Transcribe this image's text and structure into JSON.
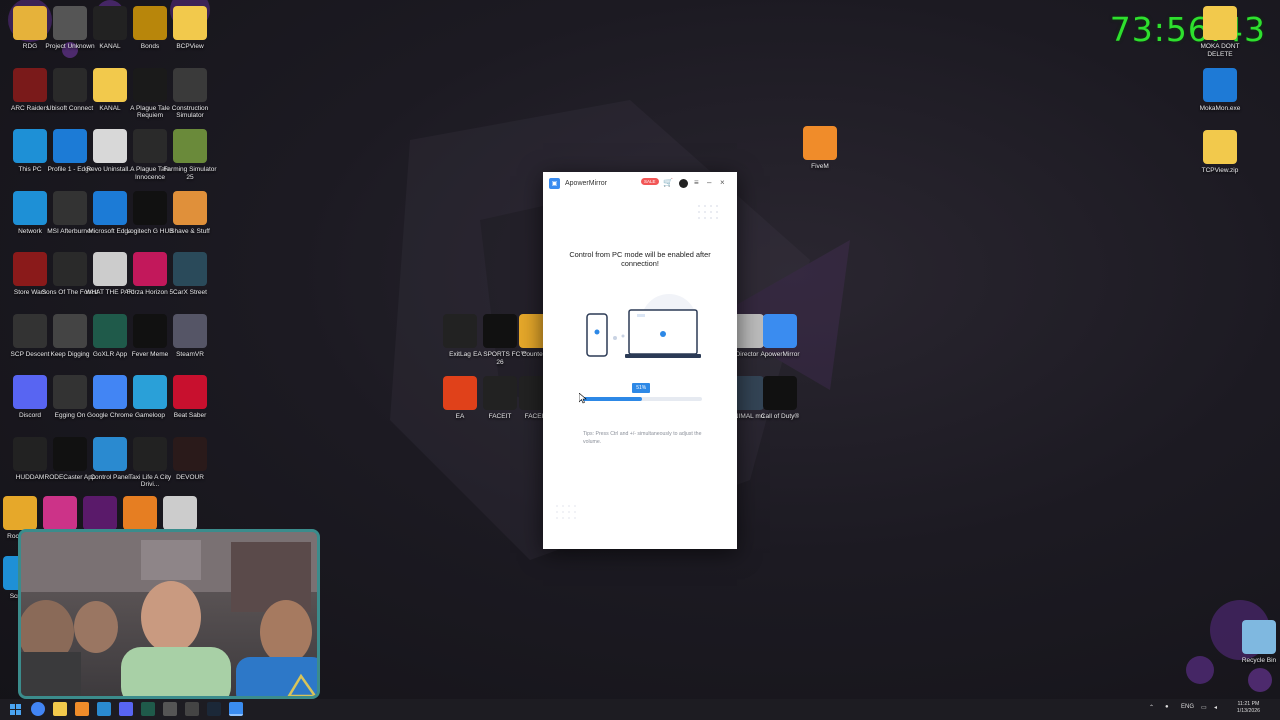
{
  "stream": {
    "timer": "73:56:43"
  },
  "desktop": {
    "left_icons": [
      {
        "label": "RDG",
        "icon": "folder-person-icon",
        "color": "#e6b23a"
      },
      {
        "label": "Project Unknown",
        "icon": "app-icon",
        "color": "#555555"
      },
      {
        "label": "KANAL",
        "icon": "network-graph-icon",
        "color": "#222222"
      },
      {
        "label": "Bonds",
        "icon": "bn-logo-icon",
        "color": "#b8860b"
      },
      {
        "label": "BCPView",
        "icon": "folder-icon",
        "color": "#f2c94c"
      },
      {
        "label": "ARC Raiders",
        "icon": "arc-raiders-icon",
        "color": "#7a1a1a"
      },
      {
        "label": "Ubisoft Connect",
        "icon": "ubisoft-icon",
        "color": "#2a2a2a"
      },
      {
        "label": "KANAL",
        "icon": "folder-icon",
        "color": "#f2c94c"
      },
      {
        "label": "A Plague Tale Requiem",
        "icon": "plague-tale-icon",
        "color": "#1a1a1a"
      },
      {
        "label": "Construction Simulator",
        "icon": "construction-sim-icon",
        "color": "#3a3a3a"
      },
      {
        "label": "This PC",
        "icon": "monitor-icon",
        "color": "#1e90d6"
      },
      {
        "label": "Profile 1 - Edge",
        "icon": "edge-icon",
        "color": "#1c7bd6"
      },
      {
        "label": "Revo Uninstall...",
        "icon": "recycle-icon",
        "color": "#d8d8d8"
      },
      {
        "label": "A Plague Tale Innocence",
        "icon": "plague-tale-icon",
        "color": "#2a2a2a"
      },
      {
        "label": "Farming Simulator 25",
        "icon": "farming-sim-icon",
        "color": "#6a8a3a"
      },
      {
        "label": "Network",
        "icon": "network-icon",
        "color": "#1e90d6"
      },
      {
        "label": "MSI Afterburner",
        "icon": "afterburner-icon",
        "color": "#333333"
      },
      {
        "label": "Microsoft Edge",
        "icon": "edge-icon",
        "color": "#1c7bd6"
      },
      {
        "label": "Logitech G HUB",
        "icon": "logitech-icon",
        "color": "#111111"
      },
      {
        "label": "Shave & Stuff",
        "icon": "shave-icon",
        "color": "#e0903a"
      },
      {
        "label": "Store Wars",
        "icon": "store-wars-icon",
        "color": "#8a1a1a"
      },
      {
        "label": "Sons Of The Forest",
        "icon": "sons-forest-icon",
        "color": "#2a2a2a"
      },
      {
        "label": "WHAT THE PAK!",
        "icon": "pak-icon",
        "color": "#cccccc"
      },
      {
        "label": "Forza Horizon 5",
        "icon": "forza-icon",
        "color": "#c2185b"
      },
      {
        "label": "CarX Street",
        "icon": "carx-icon",
        "color": "#2a4a5a"
      },
      {
        "label": "SCP Descent",
        "icon": "scp-icon",
        "color": "#333333"
      },
      {
        "label": "Keep Digging",
        "icon": "pickaxe-icon",
        "color": "#444444"
      },
      {
        "label": "GoXLR App",
        "icon": "goxlr-icon",
        "color": "#1f5a4a"
      },
      {
        "label": "Fever Meme",
        "icon": "fm-icon",
        "color": "#111111"
      },
      {
        "label": "SteamVR",
        "icon": "vr-icon",
        "color": "#555566"
      },
      {
        "label": "Discord",
        "icon": "discord-icon",
        "color": "#5865f2"
      },
      {
        "label": "Egging On",
        "icon": "egg-icon",
        "color": "#333333"
      },
      {
        "label": "Google Chrome",
        "icon": "chrome-icon",
        "color": "#4285f4"
      },
      {
        "label": "Gameloop",
        "icon": "gameloop-icon",
        "color": "#2aa0d8"
      },
      {
        "label": "Beat Saber",
        "icon": "beat-saber-icon",
        "color": "#c8102e"
      },
      {
        "label": "HUDDAM",
        "icon": "huddam-icon",
        "color": "#222222"
      },
      {
        "label": "RODECaster App",
        "icon": "rodecaster-icon",
        "color": "#111111"
      },
      {
        "label": "Control Panel",
        "icon": "control-panel-icon",
        "color": "#2a8ad0"
      },
      {
        "label": "Taxi Life A City Drivi...",
        "icon": "taxi-icon",
        "color": "#222222"
      },
      {
        "label": "DEVOUR",
        "icon": "devour-icon",
        "color": "#2a1a1a"
      }
    ],
    "extra_left_icons": [
      {
        "label": "Rocl Gar",
        "icon": "rocket-league-icon",
        "color": "#e6a82a"
      },
      {
        "label": "",
        "icon": "game-icon",
        "color": "#cc3388"
      },
      {
        "label": "",
        "icon": "game-icon",
        "color": "#5a1a6a"
      },
      {
        "label": "",
        "icon": "game-icon",
        "color": "#e67e22"
      },
      {
        "label": "",
        "icon": "r-logo-icon",
        "color": "#cccccc"
      },
      {
        "label": "Screen",
        "icon": "screen-icon",
        "color": "#1e90d6"
      }
    ],
    "middle_icons": [
      {
        "label": "ExitLag",
        "icon": "exitlag-icon",
        "color": "#222222"
      },
      {
        "label": "EA SPORTS FC™ 26",
        "icon": "ea-fc-icon",
        "color": "#111111"
      },
      {
        "label": "Counter 2",
        "icon": "cs2-icon",
        "color": "#e6a82a"
      },
      {
        "label": "Director",
        "icon": "director-icon",
        "color": "#bbbbbb"
      },
      {
        "label": "ApowerMirror",
        "icon": "apowermirror-icon",
        "color": "#3a8cf0"
      },
      {
        "label": "EA",
        "icon": "ea-icon",
        "color": "#e0411a"
      },
      {
        "label": "FACEIT",
        "icon": "faceit-icon",
        "color": "#222222"
      },
      {
        "label": "FACEIT",
        "icon": "faceit-ac-icon",
        "color": "#222222"
      },
      {
        "label": "ANIMAL mo",
        "icon": "animal-icon",
        "color": "#334455"
      },
      {
        "label": "Call of Duty®",
        "icon": "cod-icon",
        "color": "#111111"
      }
    ],
    "right_icons": [
      {
        "label": "MOKA DONT DELETE",
        "icon": "folder-icon",
        "color": "#f2c94c"
      },
      {
        "label": "MokaMon.exe",
        "icon": "monitor-chart-icon",
        "color": "#1e7ad6"
      },
      {
        "label": "TCPView.zip",
        "icon": "zip-folder-icon",
        "color": "#f2c94c"
      },
      {
        "label": "FiveM",
        "icon": "fivem-icon",
        "color": "#f08c2a"
      },
      {
        "label": "Recycle Bin",
        "icon": "recycle-bin-icon",
        "color": "#7fb8e0"
      }
    ]
  },
  "app": {
    "title": "ApowerMirror",
    "sale_badge": "SALE",
    "message": "Control from PC mode will be enabled after connection!",
    "progress_percent": 51,
    "progress_label": "51%",
    "tips": "Tips: Press Ctrl and +/- simultaneously to adjust the volume.",
    "accent": "#2d88e6"
  },
  "taskbar": {
    "language": "ENG",
    "time": "11:21 PM",
    "date": "1/13/2026"
  }
}
